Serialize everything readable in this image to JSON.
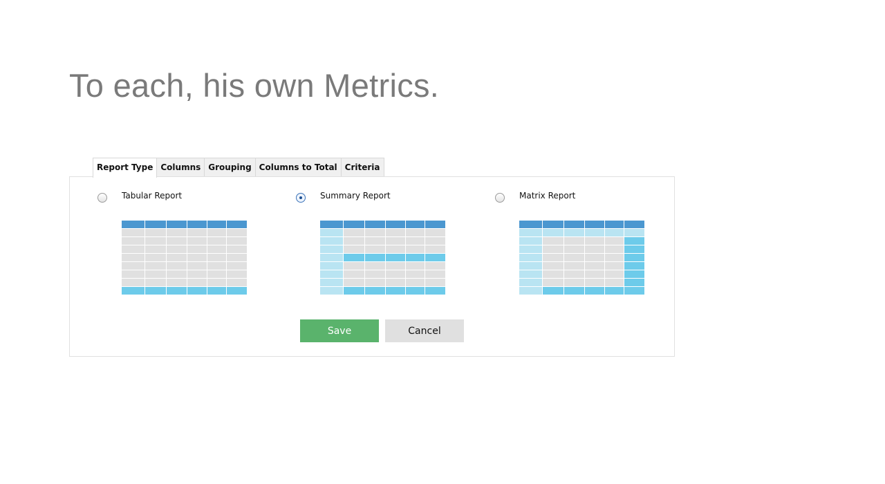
{
  "headline": "To each, his own Metrics.",
  "tabs": [
    {
      "label": "Report Type",
      "active": true
    },
    {
      "label": "Columns",
      "active": false
    },
    {
      "label": "Grouping",
      "active": false
    },
    {
      "label": "Columns to Total",
      "active": false
    },
    {
      "label": "Criteria",
      "active": false
    }
  ],
  "report_options": [
    {
      "label": "Tabular Report",
      "selected": false
    },
    {
      "label": "Summary Report",
      "selected": true
    },
    {
      "label": "Matrix Report",
      "selected": false
    }
  ],
  "actions": {
    "save_label": "Save",
    "cancel_label": "Cancel"
  },
  "colors": {
    "header_blue": "#4b97d0",
    "total_blue": "#6dcbea",
    "group_light_blue": "#b9e4f2",
    "cell_gray": "#e0e0e0",
    "save_green": "#5ab36c",
    "cancel_gray": "#e0e0e0",
    "selected_radio": "#1d4f91"
  }
}
